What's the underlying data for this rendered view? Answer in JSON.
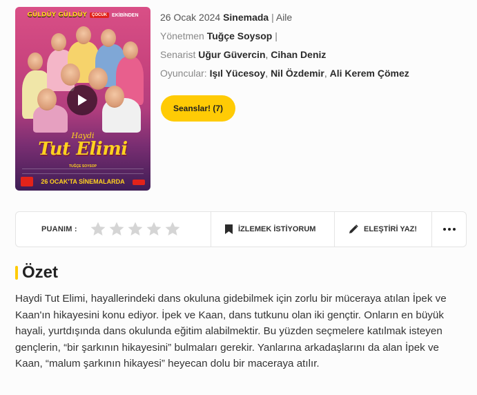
{
  "movie": {
    "release_date": "26 Ocak 2024",
    "status": "Sinemada",
    "genre": "Aile",
    "director_label": "Yönetmen",
    "director": "Tuğçe Soysop",
    "writer_label": "Senarist",
    "writers": [
      "Uğur Güvercin",
      "Cihan Deniz"
    ],
    "cast_label": "Oyuncular:",
    "cast": [
      "Işıl Yücesoy",
      "Nil Özdemir",
      "Ali Kerem Çömez"
    ]
  },
  "poster": {
    "brand": "GÜLDÜY GÜLDÜY",
    "chip": "ÇOCUK",
    "brand_suffix": "EKİBİNDEN",
    "title_small": "Haydi",
    "title_big": "Tut Elimi",
    "director_credit": "TUĞÇE SOYSOP",
    "release_banner": "26 OCAK'TA SİNEMALARDA"
  },
  "sessions_button": "Seanslar! (7)",
  "action_bar": {
    "rating_label": "PUANIM :",
    "star_count": 5,
    "rating_value": 0,
    "watchlist_label": "İZLEMEK İSTİYORUM",
    "review_label": "ELEŞTİRİ YAZ!"
  },
  "summary": {
    "heading": "Özet",
    "text": "Haydi Tut Elimi, hayallerindeki dans okuluna gidebilmek için zorlu bir müceraya atılan İpek ve Kaan'ın hikayesini konu ediyor. İpek ve Kaan, dans tutkunu olan iki gençtir. Onların en büyük hayali, yurtdışında dans okulunda eğitim alabilmektir. Bu yüzden seçmelere katılmak isteyen gençlerin, “bir şarkının hikayesini” bulmaları gerekir. Yanlarına arkadaşlarını da alan İpek ve Kaan, “malum şarkının hikayesi” heyecan dolu bir maceraya atılır."
  },
  "colors": {
    "accent": "#ffcb05",
    "star_empty": "#d5d5d5"
  }
}
